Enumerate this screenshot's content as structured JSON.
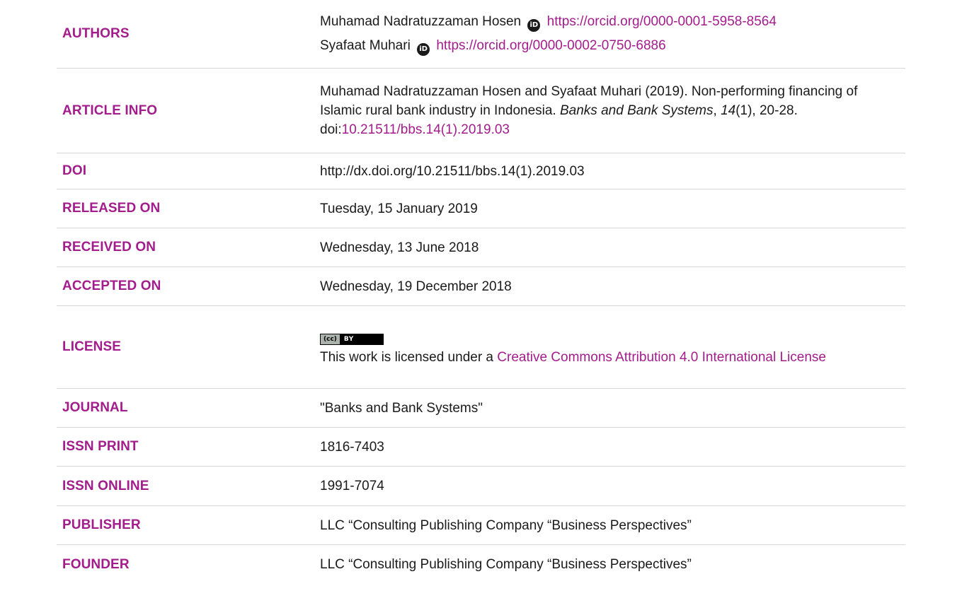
{
  "labels": {
    "authors": "AUTHORS",
    "article_info": "ARTICLE INFO",
    "doi": "DOI",
    "released_on": "RELEASED ON",
    "received_on": "RECEIVED ON",
    "accepted_on": "ACCEPTED ON",
    "license": "LICENSE",
    "journal": "JOURNAL",
    "issn_print": "ISSN PRINT",
    "issn_online": "ISSN ONLINE",
    "publisher": "PUBLISHER",
    "founder": "FOUNDER"
  },
  "authors": [
    {
      "name": "Muhamad Nadratuzzaman Hosen",
      "orcid_url": "https://orcid.org/0000-0001-5958-8564"
    },
    {
      "name": "Syafaat Muhari",
      "orcid_url": "https://orcid.org/0000-0002-0750-6886"
    }
  ],
  "orcid_icon_glyph": "iD",
  "article_info": {
    "prefix": "Muhamad Nadratuzzaman Hosen and Syafaat Muhari (2019). Non-performing financing of Islamic rural bank industry in Indonesia. ",
    "journal_italic": "Banks and Bank Systems",
    "comma": ", ",
    "volume_italic": "14",
    "rest": "(1), 20-28. doi:",
    "doi_link": "10.21511/bbs.14(1).2019.03"
  },
  "doi": "http://dx.doi.org/10.21511/bbs.14(1).2019.03",
  "released_on": "Tuesday, 15 January 2019",
  "received_on": "Wednesday, 13 June 2018",
  "accepted_on": "Wednesday, 19 December 2018",
  "license": {
    "badge_cc": "(cc)",
    "badge_by": "BY",
    "prefix": "This work is licensed under a ",
    "link": "Creative Commons Attribution 4.0 International License"
  },
  "journal": "\"Banks and Bank Systems\"",
  "issn_print": "1816-7403",
  "issn_online": "1991-7074",
  "publisher": "LLC “Consulting Publishing Company “Business Perspectives”",
  "founder": "LLC “Consulting Publishing Company “Business Perspectives”",
  "colors": {
    "label": "#a31c8c",
    "link": "#a31c8c",
    "text": "#1a1a1a",
    "divider": "#d6d6d6"
  }
}
